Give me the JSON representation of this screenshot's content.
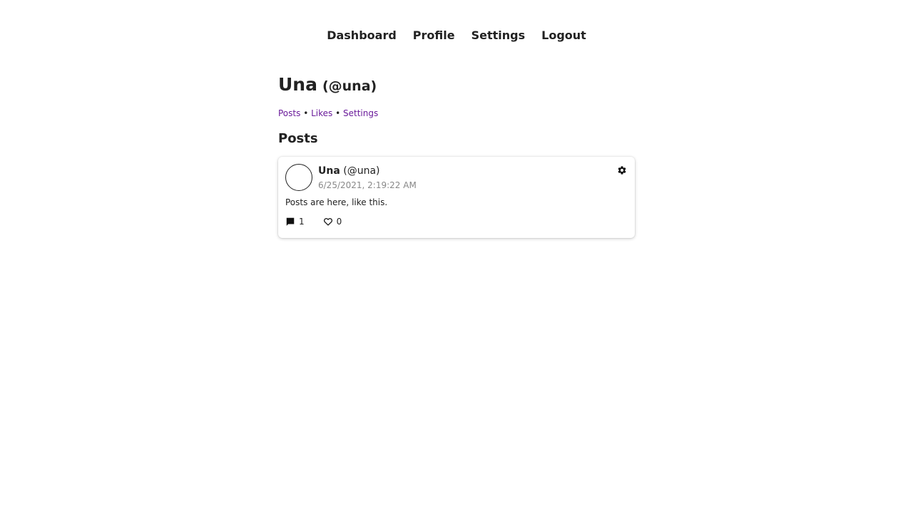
{
  "nav": {
    "items": [
      {
        "label": "Dashboard"
      },
      {
        "label": "Profile"
      },
      {
        "label": "Settings"
      },
      {
        "label": "Logout"
      }
    ]
  },
  "profile": {
    "name": "Una",
    "handle": "(@una)"
  },
  "subnav": {
    "posts": "Posts",
    "likes": "Likes",
    "settings": "Settings",
    "separator": "•"
  },
  "section": {
    "title": "Posts"
  },
  "posts": [
    {
      "author_name": "Una",
      "author_handle": "(@una)",
      "timestamp": "6/25/2021, 2:19:22 AM",
      "body": "Posts are here, like this.",
      "comment_count": "1",
      "like_count": "0",
      "icons": {
        "settings": "gear-icon",
        "comments": "comment-icon",
        "likes": "heart-icon"
      }
    }
  ],
  "colors": {
    "text": "#222222",
    "link": "#6a1b9a",
    "muted": "#888888",
    "background": "#ffffff"
  }
}
